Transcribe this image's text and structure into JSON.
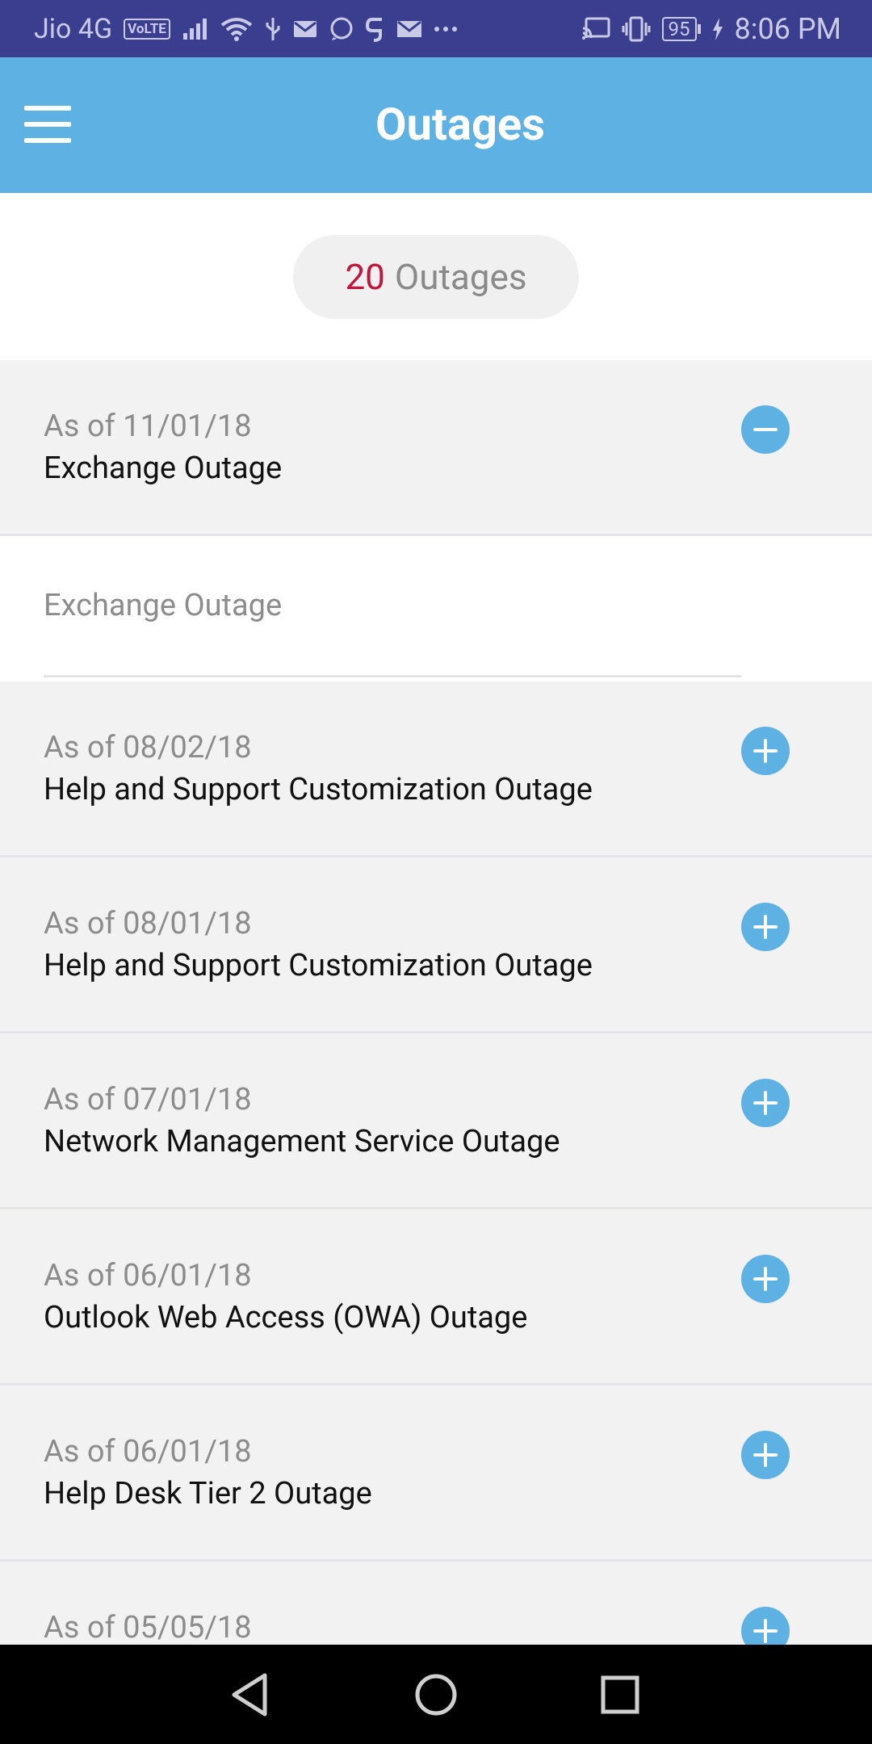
{
  "status_bar": {
    "carrier": "Jio 4G",
    "volte": "VoLTE",
    "battery": "95",
    "time": "8:06 PM"
  },
  "app_bar": {
    "title": "Outages"
  },
  "summary": {
    "count": "20",
    "label": "Outages"
  },
  "expanded": {
    "date": "As of 11/01/18",
    "title": "Exchange Outage",
    "detail": "Exchange Outage"
  },
  "outages": [
    {
      "date": "As of 08/02/18",
      "title": "Help and Support Customization Outage"
    },
    {
      "date": "As of 08/01/18",
      "title": "Help and Support Customization Outage"
    },
    {
      "date": "As of 07/01/18",
      "title": "Network Management Service Outage"
    },
    {
      "date": "As of 06/01/18",
      "title": "Outlook Web Access (OWA) Outage"
    },
    {
      "date": "As of 06/01/18",
      "title": "Help Desk Tier 2 Outage"
    },
    {
      "date": "As of 05/05/18",
      "title": ""
    }
  ],
  "colors": {
    "status_bar": "#3b3d8f",
    "app_bar": "#5db1e3",
    "accent_count": "#c0163c",
    "toggle": "#5db1e3"
  },
  "icons": {
    "menu": "hamburger-menu-icon",
    "expanded_toggle": "minus-circle-icon",
    "collapsed_toggle": "plus-circle-icon",
    "nav": [
      "back-triangle-icon",
      "home-circle-icon",
      "recents-square-icon"
    ]
  }
}
